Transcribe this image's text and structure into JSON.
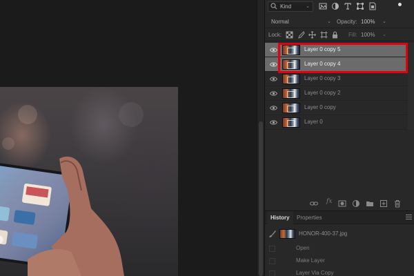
{
  "colors": {
    "panel_bg": "#282828",
    "selected_layer_bg": "#6b6b6b",
    "highlight_box": "#e3000f",
    "canvas_bg": "#1b1b1b"
  },
  "layers_panel": {
    "filter": {
      "kind_label": "Kind",
      "icons": [
        "pixel-filter-icon",
        "adjustment-filter-icon",
        "type-filter-icon",
        "shape-filter-icon",
        "smart-object-filter-icon"
      ]
    },
    "blend_mode": "Normal",
    "opacity_label": "Opacity:",
    "opacity_value": "100%",
    "lock_label": "Lock:",
    "lock_icons": [
      "lock-transparent-icon",
      "lock-image-icon",
      "lock-position-icon",
      "lock-artboard-icon",
      "lock-all-icon"
    ],
    "fill_label": "Fill:",
    "fill_value": "100%",
    "layers": [
      {
        "name": "Layer 0 copy 5",
        "selected": true
      },
      {
        "name": "Layer 0 copy 4",
        "selected": true
      },
      {
        "name": "Layer 0 copy 3",
        "selected": false
      },
      {
        "name": "Layer 0 copy 2",
        "selected": false
      },
      {
        "name": "Layer 0 copy",
        "selected": false
      },
      {
        "name": "Layer 0",
        "selected": false
      }
    ],
    "footer_icons": [
      "link-layers-icon",
      "fx-icon",
      "add-mask-icon",
      "adjustment-layer-icon",
      "new-group-icon",
      "new-layer-icon",
      "delete-layer-icon"
    ],
    "fx_label": "fx"
  },
  "history_panel": {
    "tabs": [
      "History",
      "Properties"
    ],
    "active_tab": "History",
    "snapshot_name": "HONOR-400-37.jpg",
    "states": [
      "Open",
      "Make Layer",
      "Layer Via Copy"
    ]
  }
}
